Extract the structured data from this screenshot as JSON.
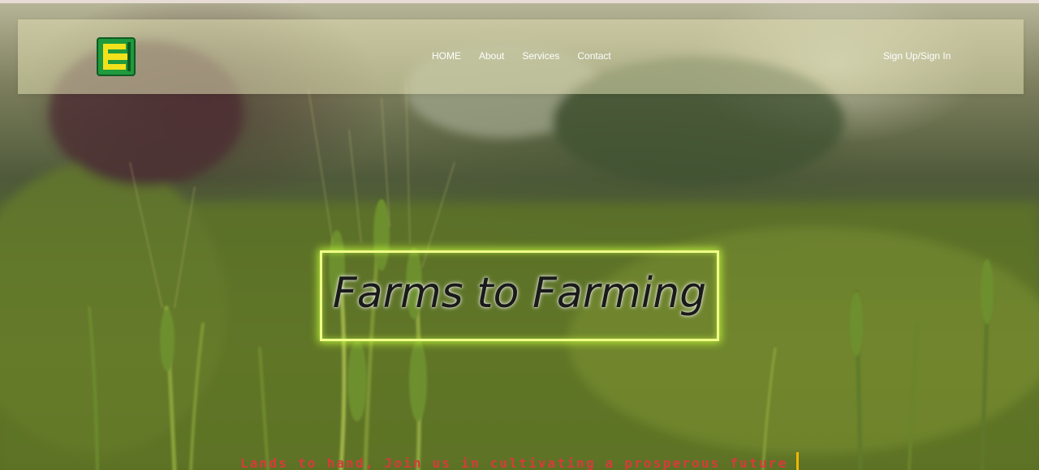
{
  "nav": {
    "logo_icon": "green-yellow-block-logo",
    "links": [
      "HOME",
      "About",
      "Services",
      "Contact"
    ],
    "signin_label": "Sign Up/Sign In"
  },
  "hero": {
    "title": "Farms to Farming",
    "tagline": "Lands to hand, Join us in cultivating a prosperous future"
  },
  "colors": {
    "frame_glow": "#efff8a",
    "tagline": "#d63b3b",
    "caret": "#f2b600",
    "logo_green": "#1f9a3c",
    "logo_yellow": "#f2e21c"
  }
}
